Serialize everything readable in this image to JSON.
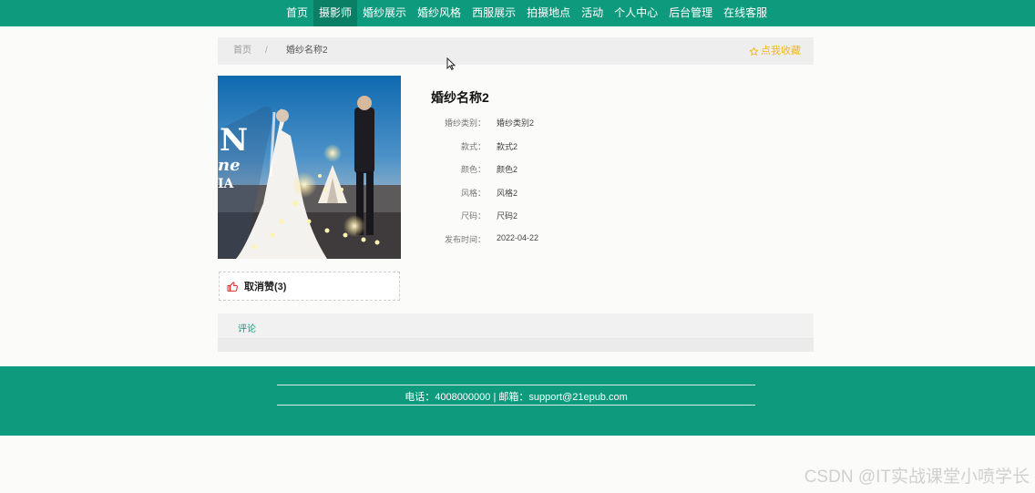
{
  "nav": {
    "items": [
      "首页",
      "摄影师",
      "婚纱展示",
      "婚纱风格",
      "西服展示",
      "拍摄地点",
      "活动",
      "个人中心",
      "后台管理",
      "在线客服"
    ],
    "active_index": 1
  },
  "breadcrumb": {
    "home": "首页",
    "separator": "/",
    "current": "婚纱名称2",
    "favorite": "点我收藏"
  },
  "product": {
    "title": "婚纱名称2",
    "fields": [
      {
        "label": "婚纱类别：",
        "value": "婚纱类别2"
      },
      {
        "label": "款式：",
        "value": "款式2"
      },
      {
        "label": "颜色：",
        "value": "颜色2"
      },
      {
        "label": "风格：",
        "value": "风格2"
      },
      {
        "label": "尺码：",
        "value": "尺码2"
      },
      {
        "label": "发布时间：",
        "value": "2022-04-22"
      }
    ]
  },
  "like": {
    "label": "取消赞(3)",
    "icon": "thumbs-up-icon"
  },
  "tabs": {
    "comment": "评论"
  },
  "footer": {
    "contact": "电话：4008000000 | 邮箱：support@21epub.com"
  },
  "watermark": "CSDN @IT实战课堂小喷学长",
  "colors": {
    "brand": "#0e9b7d",
    "favorite": "#f2b71f",
    "like_icon": "#d9342b"
  }
}
